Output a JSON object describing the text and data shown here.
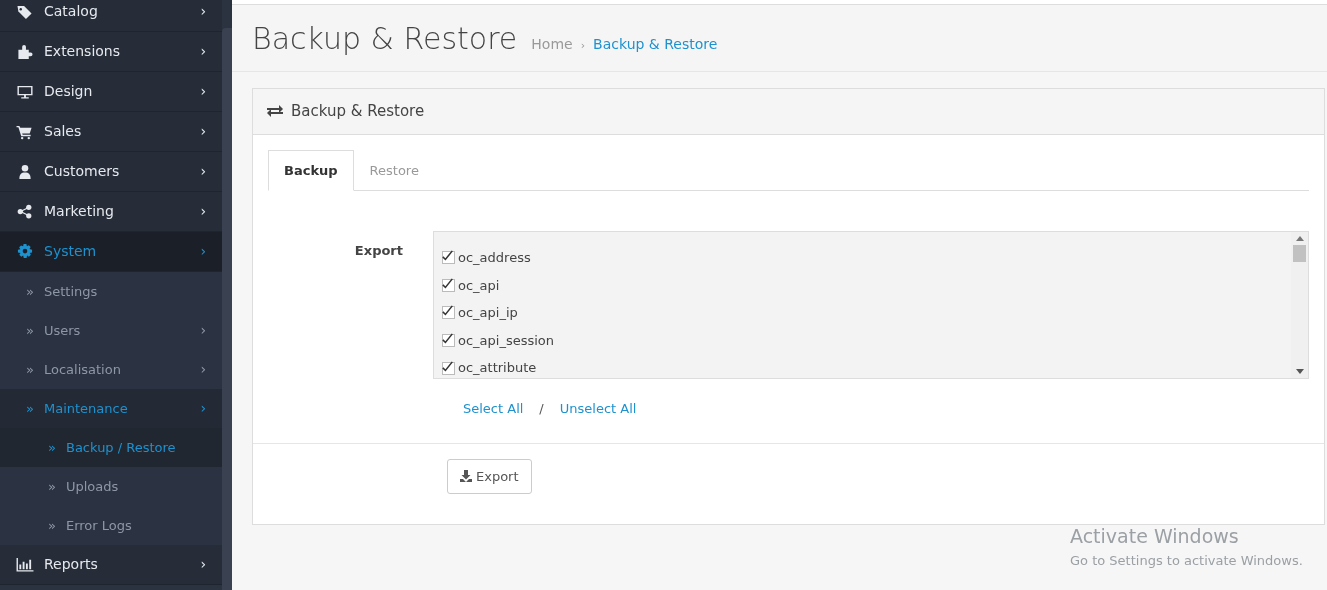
{
  "sidebar": {
    "items": [
      {
        "label": "Catalog",
        "selected": false,
        "chevron": "›"
      },
      {
        "label": "Extensions",
        "selected": false,
        "chevron": "›"
      },
      {
        "label": "Design",
        "selected": false,
        "chevron": "›"
      },
      {
        "label": "Sales",
        "selected": false,
        "chevron": "›"
      },
      {
        "label": "Customers",
        "selected": false,
        "chevron": "›"
      },
      {
        "label": "Marketing",
        "selected": false,
        "chevron": "›"
      },
      {
        "label": "System",
        "selected": true,
        "chevron": "›",
        "children": [
          {
            "bullet": "»",
            "label": "Settings",
            "selected": false
          },
          {
            "bullet": "»",
            "label": "Users",
            "selected": false,
            "chevron": "›"
          },
          {
            "bullet": "»",
            "label": "Localisation",
            "selected": false,
            "chevron": "›"
          },
          {
            "bullet": "»",
            "label": "Maintenance",
            "selected": true,
            "chevron": "›",
            "children": [
              {
                "bullet": "»",
                "label": "Backup / Restore",
                "selected": true
              },
              {
                "bullet": "»",
                "label": "Uploads",
                "selected": false
              },
              {
                "bullet": "»",
                "label": "Error Logs",
                "selected": false
              }
            ]
          }
        ]
      },
      {
        "label": "Reports",
        "selected": false,
        "chevron": "›"
      }
    ]
  },
  "page_header": {
    "title": "Backup & Restore",
    "breadcrumb": [
      {
        "label": "Home",
        "selected": false
      },
      {
        "separator": "›",
        "label": "Backup & Restore",
        "selected": true
      }
    ]
  },
  "panel": {
    "title": "Backup & Restore",
    "tabs": [
      {
        "label": "Backup",
        "selected": true
      },
      {
        "label": "Restore",
        "selected": false
      }
    ],
    "export_label": "Export",
    "tables": [
      {
        "name": "oc_address",
        "checked": true
      },
      {
        "name": "oc_api",
        "checked": true
      },
      {
        "name": "oc_api_ip",
        "checked": true
      },
      {
        "name": "oc_api_session",
        "checked": true
      },
      {
        "name": "oc_attribute",
        "checked": true
      }
    ],
    "select_all": "Select All",
    "separator": "/",
    "unselect_all": "Unselect All",
    "export_button": "Export"
  },
  "os_notice": {
    "title": "Activate Windows",
    "text": "Go to Settings to activate Windows."
  }
}
